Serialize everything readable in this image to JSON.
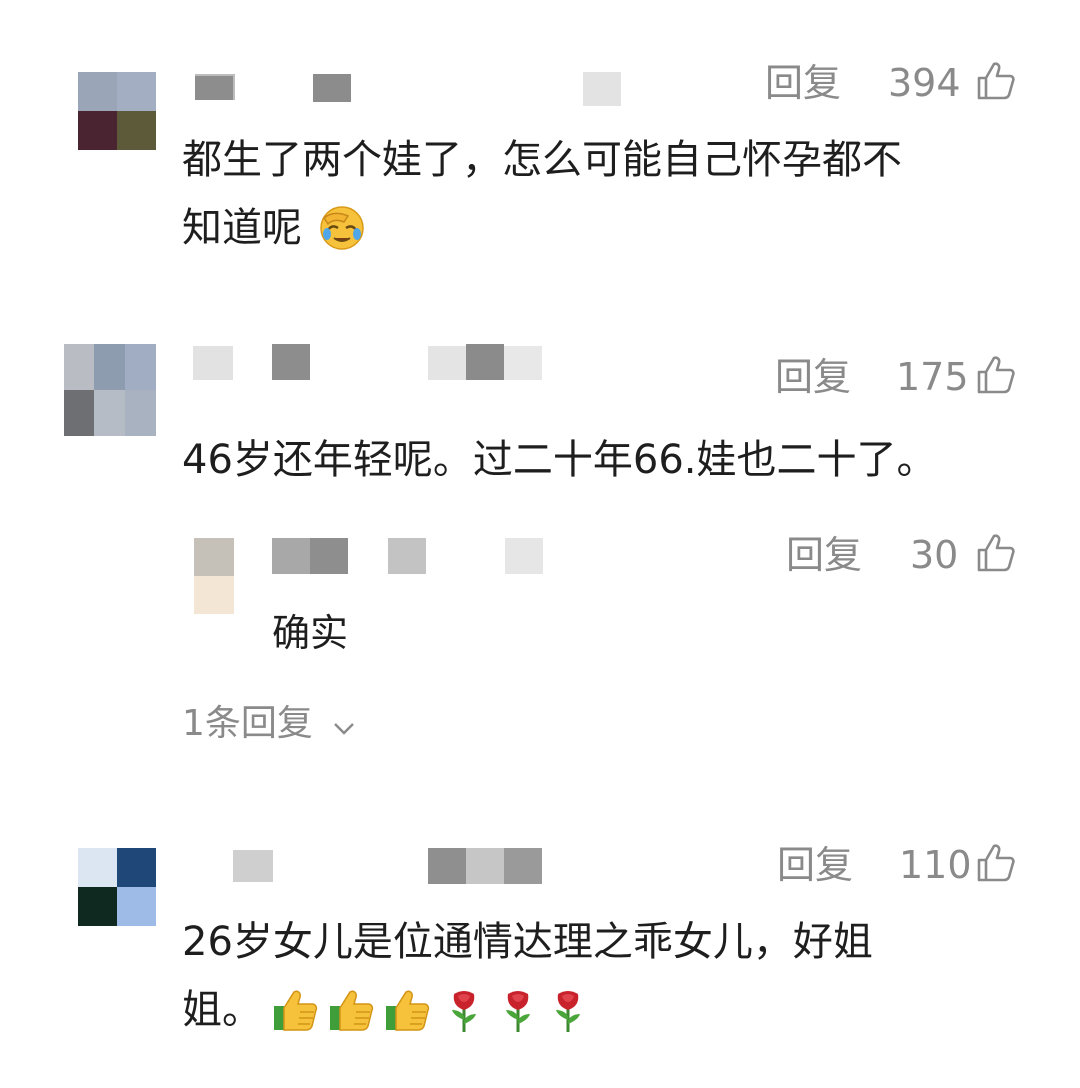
{
  "comments": [
    {
      "reply_label": "回复",
      "likes": "394",
      "text_line1": "都生了两个娃了，怎么可能自己怀孕都不",
      "text_line2": "知道呢",
      "emoji": "facepalm-emoji"
    },
    {
      "reply_label": "回复",
      "likes": "175",
      "text_line1": "46岁还年轻呢。过二十年66.娃也二十了。",
      "sub_reply": {
        "reply_label": "回复",
        "likes": "30",
        "text": "确实"
      },
      "more_replies_label": "1条回复"
    },
    {
      "reply_label": "回复",
      "likes": "110",
      "text_line1": "26岁女儿是位通情达理之乖女儿，好姐",
      "text_line2": "姐。",
      "emojis": [
        "thumbs-up-emoji",
        "thumbs-up-emoji",
        "thumbs-up-emoji",
        "rose-emoji",
        "rose-emoji",
        "rose-emoji"
      ]
    }
  ],
  "colors": {
    "meta_gray": "#8a8a8a",
    "text": "#1e1e1e"
  }
}
